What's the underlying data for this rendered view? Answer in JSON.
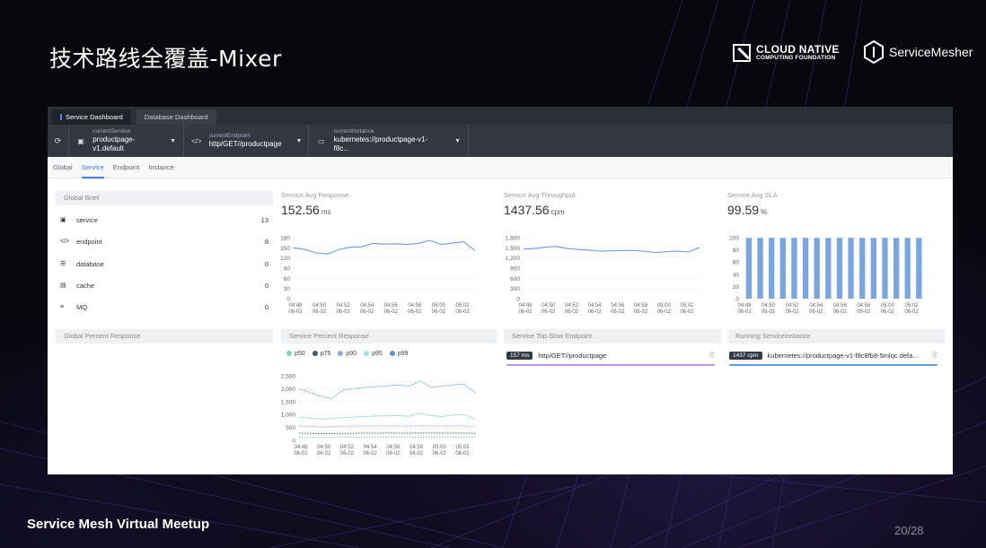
{
  "slide": {
    "title": "技术路线全覆盖-Mixer",
    "footer": "Service Mesh Virtual Meetup",
    "page": "20/28",
    "logos": {
      "cncf_line1": "CLOUD NATIVE",
      "cncf_line2": "COMPUTING FOUNDATION",
      "servicemesher": "ServiceMesher"
    }
  },
  "topbar": {
    "tabs": [
      "Service Dashboard",
      "Database Dashboard"
    ]
  },
  "selectors": [
    {
      "label": "currentService",
      "value": "productpage-v1.default"
    },
    {
      "label": "currentEndpoint",
      "value": "http/GET//productpage"
    },
    {
      "label": "currentInstance",
      "value": "kubernetes://productpage-v1-f8c..."
    }
  ],
  "subtabs": [
    "Global",
    "Service",
    "Endpoint",
    "Instance"
  ],
  "global_brief": {
    "title": "Global Brief",
    "items": [
      {
        "name": "service",
        "count": "13"
      },
      {
        "name": "endpoint",
        "count": "8"
      },
      {
        "name": "database",
        "count": "0"
      },
      {
        "name": "cache",
        "count": "0"
      },
      {
        "name": "MQ",
        "count": "0"
      }
    ]
  },
  "global_percent_title": "Global Percent Response",
  "metrics": [
    {
      "label": "Service Avg Response",
      "value": "152.56",
      "unit": "ms"
    },
    {
      "label": "Service Avg Throughput",
      "value": "1437.56",
      "unit": "cpm"
    },
    {
      "label": "Service Avg SLA",
      "value": "99.59",
      "unit": "%"
    }
  ],
  "time_ticks": [
    "04:48\n06-02",
    "04:50\n06-02",
    "04:52\n06-02",
    "04:54\n06-02",
    "04:56\n06-02",
    "04:58\n06-02",
    "05:00\n06-02",
    "05:02\n06-02"
  ],
  "chart_data": [
    {
      "type": "line",
      "title": "Service Avg Response",
      "x_ticks": [
        "04:48\n06-02",
        "04:50\n06-02",
        "04:52\n06-02",
        "04:54\n06-02",
        "04:56\n06-02",
        "04:58\n06-02",
        "05:00\n06-02",
        "05:02\n06-02"
      ],
      "values": [
        150,
        145,
        135,
        132,
        145,
        152,
        153,
        163,
        161,
        162,
        160,
        163,
        172,
        160,
        164,
        168,
        142
      ],
      "y_ticks": [
        0,
        30,
        60,
        90,
        120,
        150,
        180
      ],
      "ylim": [
        0,
        180
      ],
      "color": "#6f9bd8"
    },
    {
      "type": "line",
      "title": "Service Avg Throughput",
      "x_ticks": [
        "04:48\n06-02",
        "04:50\n06-02",
        "04:52\n06-02",
        "04:54\n06-02",
        "04:56\n06-02",
        "04:58\n06-02",
        "05:00\n06-02",
        "05:02\n06-02"
      ],
      "values": [
        1460,
        1480,
        1520,
        1540,
        1480,
        1450,
        1430,
        1400,
        1410,
        1420,
        1420,
        1400,
        1360,
        1390,
        1400,
        1380,
        1510
      ],
      "y_ticks": [
        "0",
        "300",
        "600",
        "900",
        "1,200",
        "1,500",
        "1,800"
      ],
      "ylim": [
        0,
        1800
      ],
      "color": "#6f9bd8"
    },
    {
      "type": "bar",
      "title": "Service Avg SLA",
      "x_ticks": [
        "04:48\n06-02",
        "04:50\n06-02",
        "04:52\n06-02",
        "04:54\n06-02",
        "04:56\n06-02",
        "04:58\n06-02",
        "05:00\n06-02",
        "05:02\n06-02"
      ],
      "values": [
        99.5,
        99.6,
        99.6,
        99.5,
        99.7,
        99.6,
        99.6,
        99.5,
        99.6,
        99.6,
        99.6,
        99.5,
        99.6,
        99.6,
        99.6,
        99.6
      ],
      "y_ticks": [
        0,
        20,
        40,
        60,
        80,
        100
      ],
      "ylim": [
        0,
        100
      ],
      "color": "#7aa6e0"
    },
    {
      "type": "line",
      "title": "Service Percent Response",
      "x_ticks": [
        "04:48\n06-02",
        "04:50\n06-02",
        "04:52\n06-02",
        "04:54\n06-02",
        "04:56\n06-02",
        "04:58\n06-02",
        "05:00\n06-02",
        "05:02\n06-02"
      ],
      "y_ticks": [
        "0",
        "500",
        "1,000",
        "1,500",
        "2,000",
        "2,500"
      ],
      "ylim": [
        0,
        2500
      ],
      "series": [
        {
          "name": "p50",
          "color": "#7fd3ae",
          "values": [
            120,
            110,
            105,
            110,
            115,
            118,
            120,
            118,
            122,
            120,
            118,
            120,
            122,
            118,
            120,
            121,
            115
          ]
        },
        {
          "name": "p75",
          "color": "#4a5566",
          "values": [
            280,
            270,
            260,
            262,
            270,
            275,
            278,
            275,
            282,
            280,
            278,
            285,
            282,
            278,
            280,
            282,
            270
          ]
        },
        {
          "name": "p90",
          "color": "#9aa6dd",
          "values": [
            560,
            540,
            520,
            530,
            545,
            555,
            560,
            555,
            565,
            560,
            555,
            570,
            565,
            560,
            562,
            565,
            540
          ]
        },
        {
          "name": "p95",
          "color": "#a9dede",
          "values": [
            900,
            860,
            830,
            850,
            880,
            900,
            920,
            940,
            950,
            960,
            930,
            1050,
            960,
            920,
            980,
            1000,
            820
          ]
        },
        {
          "name": "p99",
          "color": "#5b8fd6",
          "values": [
            2000,
            1850,
            1700,
            1620,
            1950,
            2000,
            2050,
            2080,
            2100,
            2150,
            2100,
            2300,
            2050,
            2100,
            2150,
            2180,
            1850
          ]
        }
      ]
    }
  ],
  "percent_response_title": "Service Percent Response",
  "slow_endpoint": {
    "title": "Service Top Slow Endpoint",
    "badge": "157 ms",
    "name": "http/GET//productpage"
  },
  "running_instance": {
    "title": "Running ServiceInstance",
    "badge": "1437 cpm",
    "name": "kubernetes://productpage-v1-f8c8fb8-5mlqc.defa..."
  }
}
